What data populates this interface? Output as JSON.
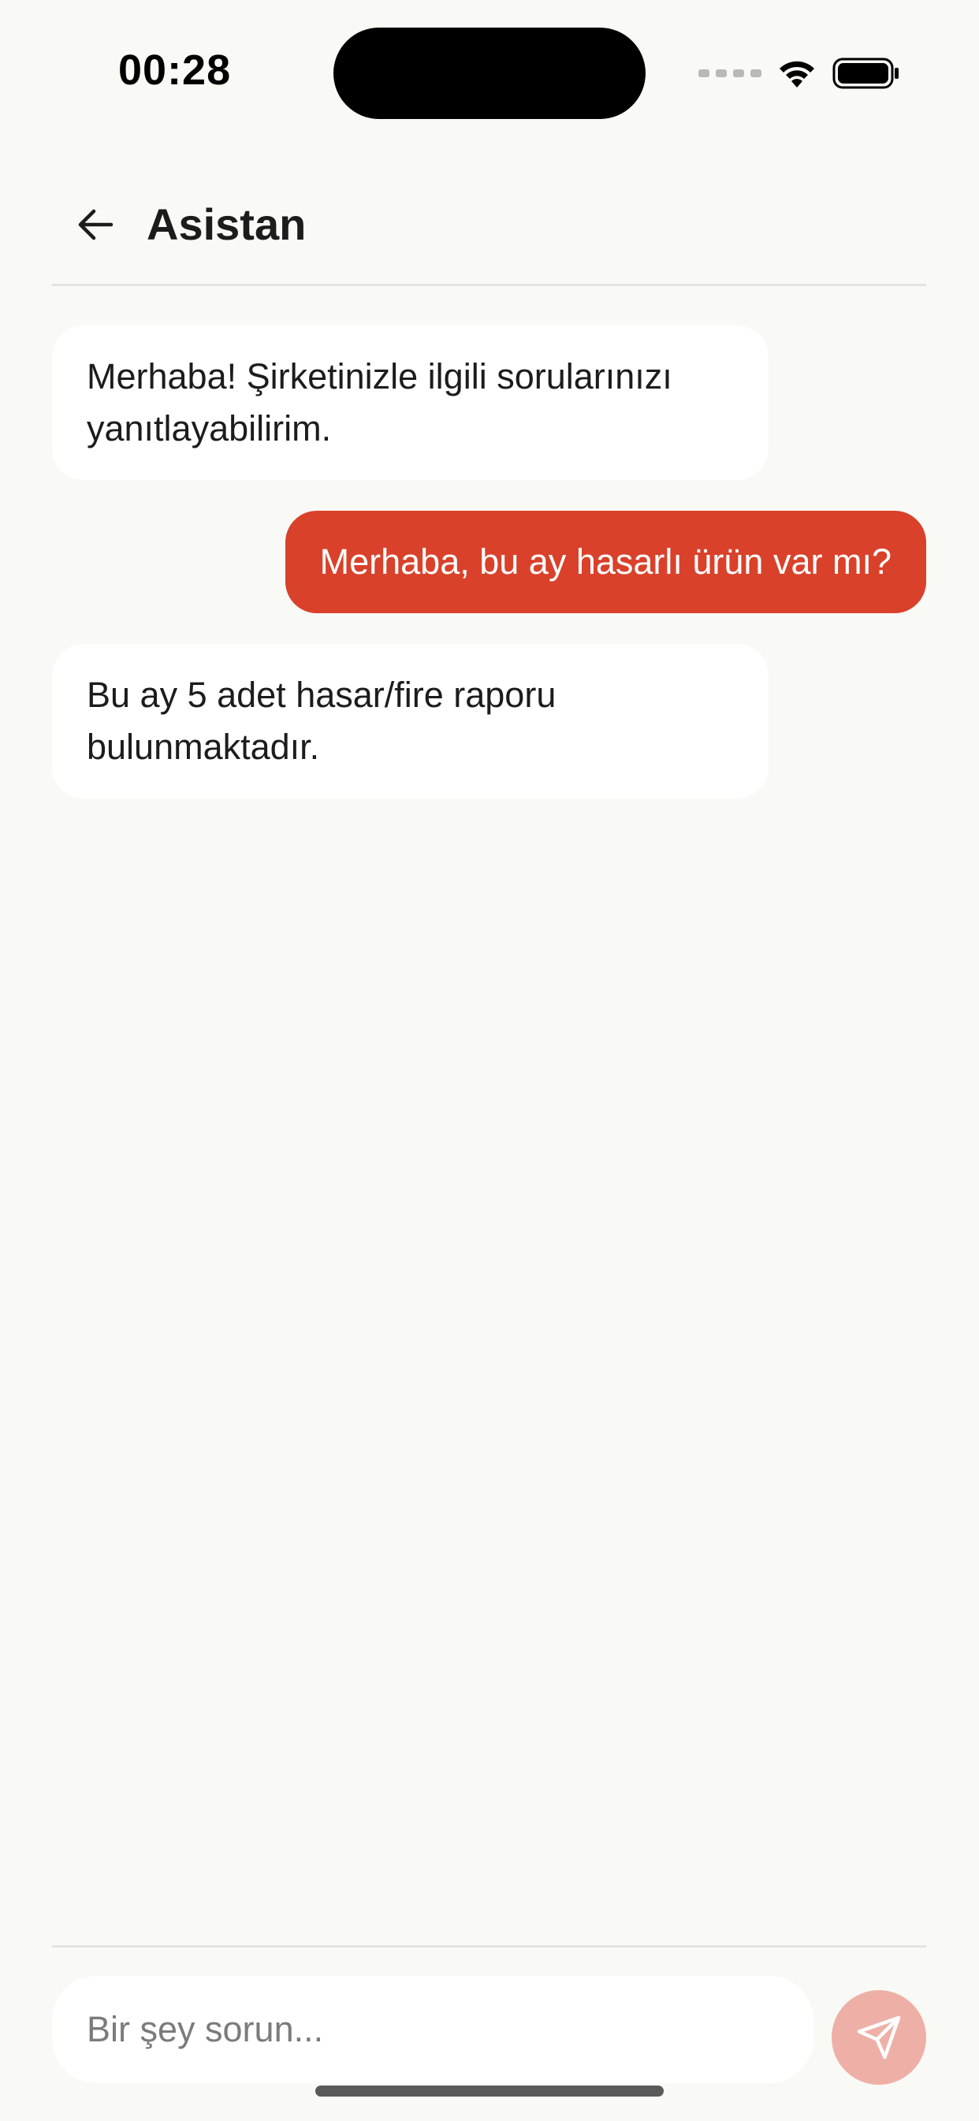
{
  "status_bar": {
    "time": "00:28"
  },
  "header": {
    "title": "Asistan",
    "back_icon": "arrow-left-icon"
  },
  "messages": [
    {
      "sender": "bot",
      "text": "Merhaba! Şirketinizle ilgili sorularınızı yanıtlayabilirim."
    },
    {
      "sender": "user",
      "text": "Merhaba, bu ay hasarlı ürün var mı?"
    },
    {
      "sender": "bot",
      "text": "Bu ay 5 adet hasar/fire raporu bulunmaktadır."
    }
  ],
  "composer": {
    "placeholder": "Bir şey sorun...",
    "value": "",
    "send_icon": "send-icon"
  },
  "colors": {
    "background": "#f9f9f6",
    "accent": "#d9412a",
    "send_disabled": "#eeb0a6",
    "bot_bubble": "#ffffff"
  }
}
